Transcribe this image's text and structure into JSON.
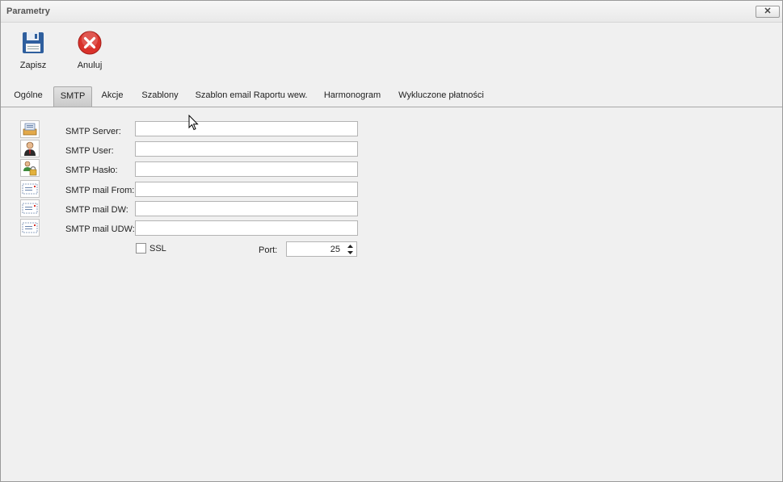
{
  "window": {
    "title": "Parametry",
    "close_glyph": "✕"
  },
  "toolbar": {
    "save_label": "Zapisz",
    "save_icon": "floppy-disk-icon",
    "cancel_label": "Anuluj",
    "cancel_icon": "cancel-x-icon"
  },
  "tabs": [
    {
      "label": "Ogólne",
      "active": false
    },
    {
      "label": "SMTP",
      "active": true
    },
    {
      "label": "Akcje",
      "active": false
    },
    {
      "label": "Szablony",
      "active": false
    },
    {
      "label": "Szablon email Raportu wew.",
      "active": false
    },
    {
      "label": "Harmonogram",
      "active": false
    },
    {
      "label": "Wykluczone płatności",
      "active": false
    }
  ],
  "smtp": {
    "fields": [
      {
        "label": "SMTP Server:",
        "value": "",
        "icon": "server-icon"
      },
      {
        "label": "SMTP User:",
        "value": "",
        "icon": "user-icon"
      },
      {
        "label": "SMTP Hasło:",
        "value": "",
        "icon": "user-lock-icon"
      },
      {
        "label": "SMTP mail From:",
        "value": "",
        "icon": "envelope-icon"
      },
      {
        "label": "SMTP mail DW:",
        "value": "",
        "icon": "envelope-icon"
      },
      {
        "label": "SMTP mail UDW:",
        "value": "",
        "icon": "envelope-icon"
      }
    ],
    "ssl_label": "SSL",
    "ssl_checked": false,
    "port_label": "Port:",
    "port_value": "25"
  },
  "colors": {
    "accent_red": "#d9322b",
    "floppy_blue": "#2f5f9e",
    "tab_active": "#cfcfcf"
  }
}
